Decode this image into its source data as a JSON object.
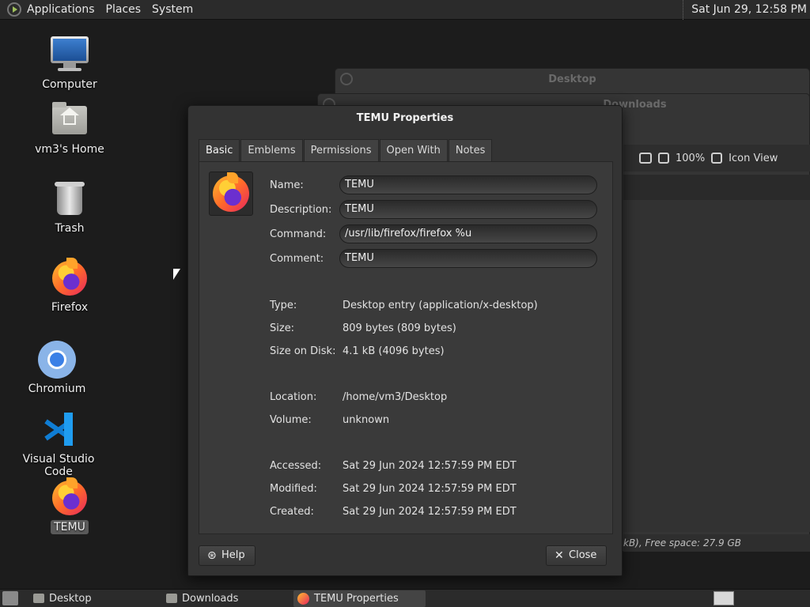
{
  "top_panel": {
    "menus": [
      "Applications",
      "Places",
      "System"
    ],
    "clock": "Sat Jun 29, 12:58 PM"
  },
  "desktop_icons": {
    "computer": "Computer",
    "home": "vm3's Home",
    "trash": "Trash",
    "firefox": "Firefox",
    "chromium": "Chromium",
    "vscode": "Visual Studio Code",
    "temu": "TEMU"
  },
  "background_windows": {
    "desktop_title": "Desktop",
    "downloads_title": "Downloads",
    "zoom": "100%",
    "view_mode": "Icon View",
    "status": "kB), Free space: 27.9 GB"
  },
  "dialog": {
    "title": "TEMU Properties",
    "tabs": [
      "Basic",
      "Emblems",
      "Permissions",
      "Open With",
      "Notes"
    ],
    "active_tab": "Basic",
    "fields": {
      "name_label": "Name:",
      "name_value": "TEMU",
      "description_label": "Description:",
      "description_value": "TEMU",
      "command_label": "Command:",
      "command_value": "/usr/lib/firefox/firefox %u",
      "comment_label": "Comment:",
      "comment_value": "TEMU"
    },
    "info": {
      "type_label": "Type:",
      "type_value": "Desktop entry (application/x-desktop)",
      "size_label": "Size:",
      "size_value": "809 bytes (809 bytes)",
      "disk_label": "Size on Disk:",
      "disk_value": "4.1 kB (4096 bytes)",
      "location_label": "Location:",
      "location_value": "/home/vm3/Desktop",
      "volume_label": "Volume:",
      "volume_value": "unknown",
      "accessed_label": "Accessed:",
      "accessed_value": "Sat 29 Jun 2024 12:57:59 PM EDT",
      "modified_label": "Modified:",
      "modified_value": "Sat 29 Jun 2024 12:57:59 PM EDT",
      "created_label": "Created:",
      "created_value": "Sat 29 Jun 2024 12:57:59 PM EDT"
    },
    "help_label": "Help",
    "close_label": "Close"
  },
  "taskbar": {
    "tasks": [
      "Desktop",
      "Downloads",
      "TEMU Properties"
    ],
    "active_task": "TEMU Properties"
  }
}
